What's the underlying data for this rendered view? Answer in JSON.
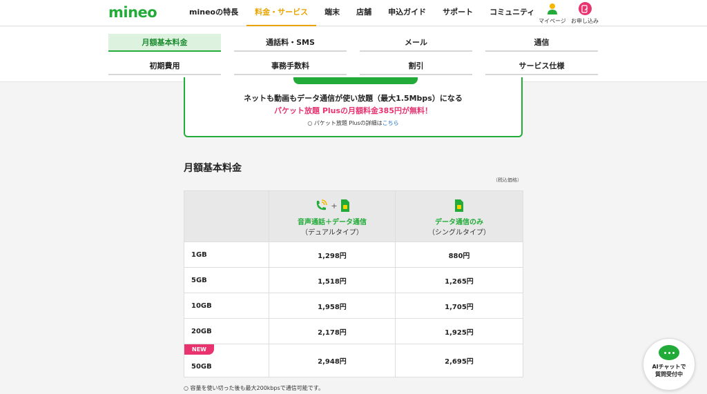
{
  "header": {
    "logo": "mineo",
    "nav": [
      "mineoの特長",
      "料金・サービス",
      "端末",
      "店舗",
      "申込ガイド",
      "サポート",
      "コミュニティ"
    ],
    "mypage_label": "マイページ",
    "apply_label": "お申し込み"
  },
  "subnav": {
    "row1": [
      "月額基本料金",
      "通話料・SMS",
      "メール",
      "通信"
    ],
    "row2": [
      "初期費用",
      "事務手数料",
      "割引",
      "サービス仕様"
    ]
  },
  "promo": {
    "line1": "ネットも動画もデータ通信が使い放題（最大1.5Mbps）になる",
    "line2": "パケット放題 Plusの月額料金385円が無料！",
    "detail_prefix": "○ パケット放題 Plusの詳細は",
    "detail_link": "こちら"
  },
  "section": {
    "title": "月額基本料金",
    "tax_note": "（税込価格）"
  },
  "table": {
    "col1_main": "音声通話＋データ通信",
    "col1_sub": "（デュアルタイプ）",
    "col2_main": "データ通信のみ",
    "col2_sub": "（シングルタイプ）",
    "rows": [
      {
        "plan": "1GB",
        "dual": "1,298円",
        "single": "880円"
      },
      {
        "plan": "5GB",
        "dual": "1,518円",
        "single": "1,265円"
      },
      {
        "plan": "10GB",
        "dual": "1,958円",
        "single": "1,705円"
      },
      {
        "plan": "20GB",
        "dual": "2,178円",
        "single": "1,925円"
      },
      {
        "plan": "50GB",
        "dual": "2,948円",
        "single": "2,695円",
        "badge": "NEW"
      }
    ]
  },
  "footnote": "○ 容量を使い切った後も最大200kbpsで通信可能です。",
  "ai_chat": {
    "line1": "AIチャットで",
    "line2": "質問受付中"
  },
  "colors": {
    "brand_green": "#22ab38",
    "active_orange": "#e8a400",
    "accent_pink": "#e8336f",
    "link_blue": "#1a73c7"
  }
}
